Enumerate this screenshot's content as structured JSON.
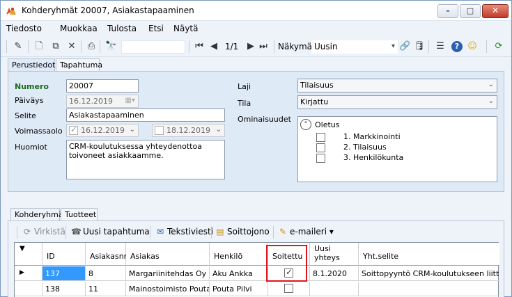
{
  "window": {
    "title": "Kohderyhmät 20007, Asiakastapaaminen",
    "minimize_glyph": "–",
    "maximize_glyph": "□",
    "close_glyph": "✕"
  },
  "menu": [
    "Tiedosto",
    "Muokkaa",
    "Tulosta",
    "Etsi",
    "Näytä"
  ],
  "toolbar": {
    "record_position": "1/1",
    "view_label": "Näkymä",
    "view_value": "Uusin",
    "icons": {
      "edit": "✎",
      "new": "🗋",
      "copy": "⧉",
      "delete": "✕",
      "print": "⎙",
      "find": "🔭",
      "first": "⏮",
      "prev": "◀",
      "next": "▶",
      "last": "⏭",
      "link": "🔗",
      "db": "🛢",
      "list": "☰",
      "help": "?",
      "user": "☺",
      "refresh": "⟳"
    }
  },
  "tabs_top": [
    "Perustiedot",
    "Tapahtuma"
  ],
  "form": {
    "numero_label": "Numero",
    "numero_value": "20007",
    "paivays_label": "Päiväys",
    "paivays_value": "16.12.2019",
    "selite_label": "Selite",
    "selite_value": "Asiakastapaaminen",
    "voimassaolo_label": "Voimassaolo",
    "voimassaolo_from": "16.12.2019",
    "voimassaolo_to": "18.12.2019",
    "huomiot_label": "Huomiot",
    "huomiot_value": "CRM-koulutuksessa yhteydenottoa toivoneet asiakkaamme.",
    "laji_label": "Laji",
    "laji_value": "Tilaisuus",
    "tila_label": "Tila",
    "tila_value": "Kirjattu",
    "ominaisuudet_label": "Ominaisuudet",
    "oletus_label": "Oletus",
    "ominaisuudet_items": [
      "1. Markkinointi",
      "2. Tilaisuus",
      "3. Henkilökunta"
    ]
  },
  "tabs_bottom": [
    "Kohderyhmä",
    "Tuotteet"
  ],
  "subtoolbar": {
    "virkista": "Virkistä",
    "uusi_tapahtuma": "Uusi tapahtuma",
    "tekstiviesti": "Tekstiviesti",
    "soittojono": "Soittojono",
    "emaileri": "e-maileri"
  },
  "grid": {
    "columns": [
      "ID",
      "Asiakasnr",
      "Asiakas",
      "Henkilö",
      "Soitettu",
      "Uusi yhteys",
      "Yht.selite"
    ],
    "rows": [
      {
        "id": "137",
        "asiakasnr": "8",
        "asiakas": "Margariinitehdas Oy",
        "henkilo": "Aku Ankka",
        "soitettu": true,
        "uusi_yhteys": "8.1.2020",
        "yht_selite": "Soittopyyntö CRM-koulutukseen liittyen"
      },
      {
        "id": "138",
        "asiakasnr": "11",
        "asiakas": "Mainostoimisto Pouta ...",
        "henkilo": "Pouta Pilvi",
        "soitettu": false,
        "uusi_yhteys": "",
        "yht_selite": ""
      }
    ]
  }
}
